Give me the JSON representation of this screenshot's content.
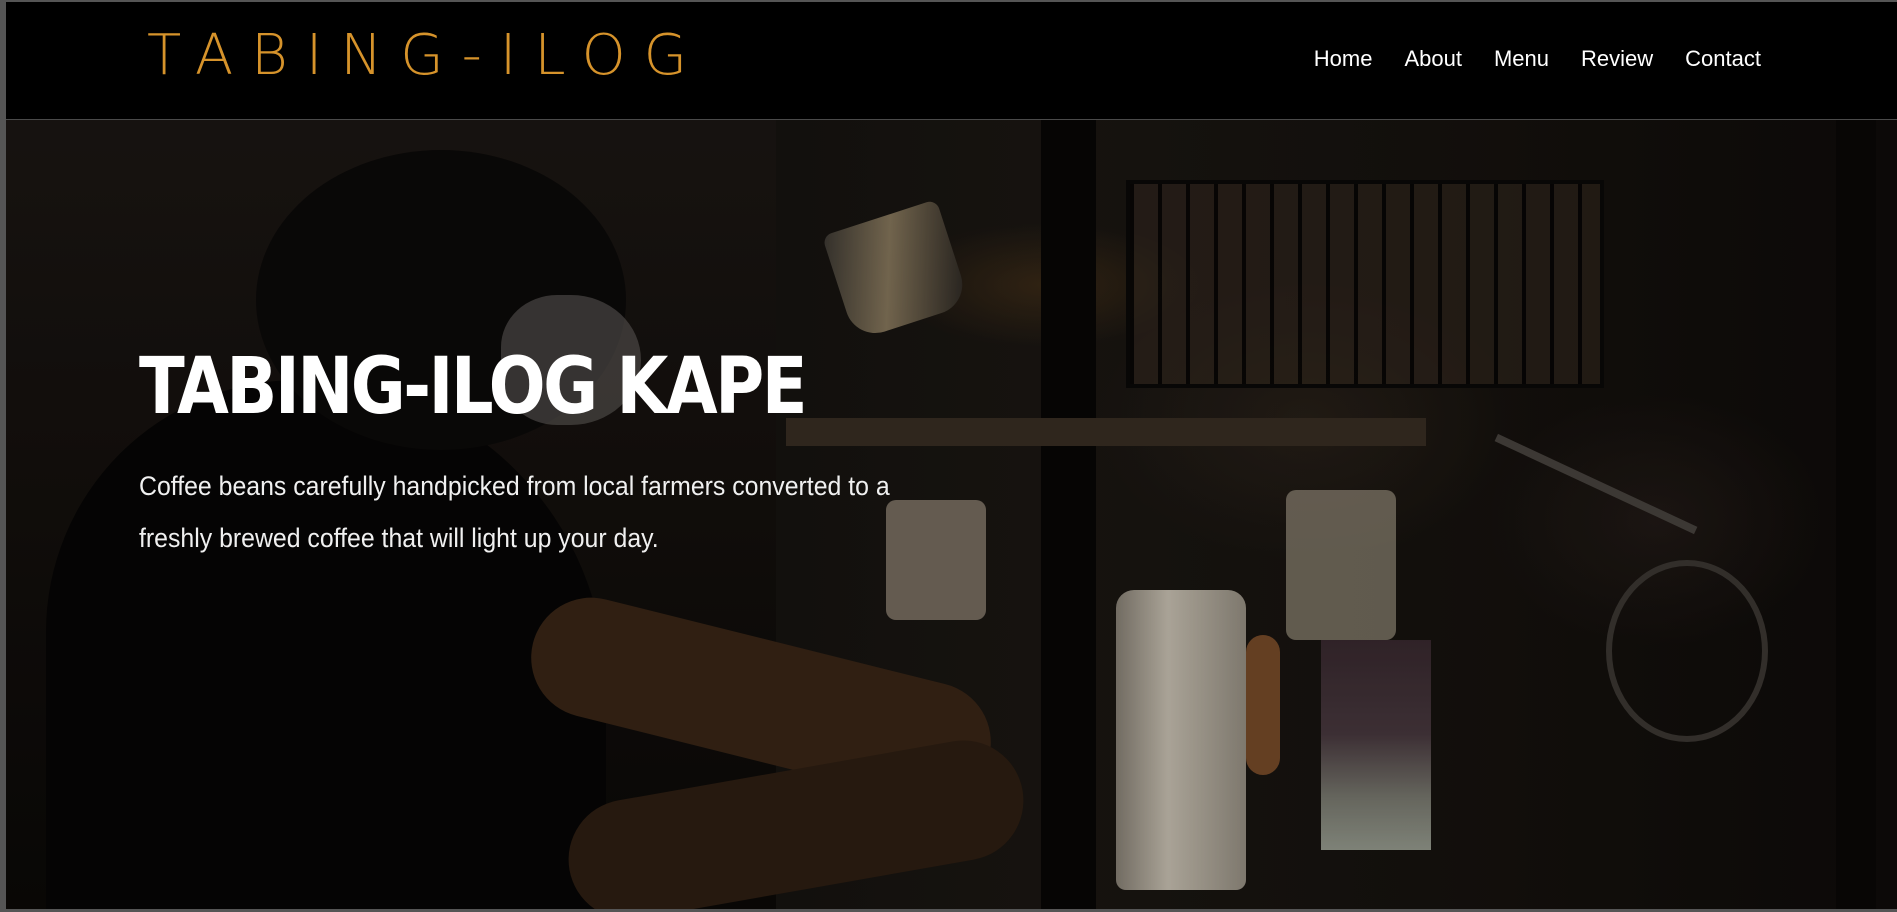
{
  "header": {
    "brand": "TABING-ILOG",
    "brand_color": "#d6932b",
    "nav": [
      {
        "label": "Home"
      },
      {
        "label": "About"
      },
      {
        "label": "Menu"
      },
      {
        "label": "Review"
      },
      {
        "label": "Contact"
      }
    ]
  },
  "hero": {
    "title": "TABING-ILOG KAPE",
    "description": "Coffee beans carefully handpicked from local farmers converted to a freshly brewed coffee that will light up your day."
  },
  "colors": {
    "nav_background": "#000000",
    "text": "#ffffff"
  }
}
